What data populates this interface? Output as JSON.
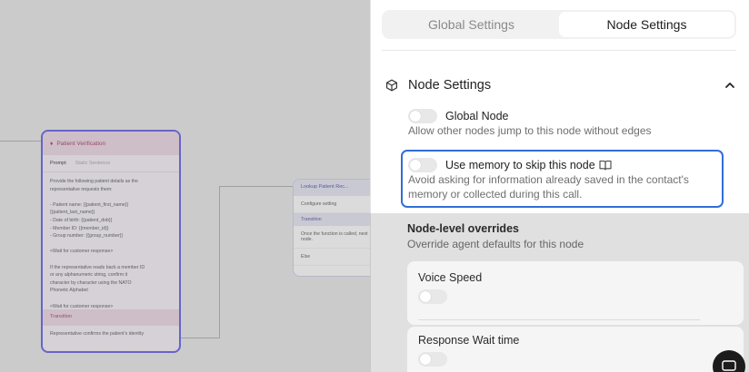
{
  "tabs": {
    "global_label": "Global Settings",
    "node_label": "Node Settings",
    "active": "Node Settings"
  },
  "section": {
    "title": "Node Settings",
    "icon": "cube-icon",
    "collapse_icon": "chevron-up-icon"
  },
  "options": {
    "global_node": {
      "title": "Global Node",
      "description": "Allow other nodes jump to this node without edges",
      "enabled": false
    },
    "memory": {
      "title": "Use memory to skip this node",
      "description": "Avoid asking for information already saved in the contact's memory or collected during this call.",
      "icon": "book-icon",
      "enabled": false
    }
  },
  "overrides": {
    "title": "Node-level overrides",
    "description": "Override agent defaults for this node",
    "voice_speed_label": "Voice Speed",
    "response_wait_label": "Response Wait time"
  },
  "canvas": {
    "patient_node": {
      "title": "Patient Verification",
      "tab_prompt": "Prompt",
      "tab_static": "Static Sentence",
      "prompt_text": "Provide the following patient details as the\nrepresentative requests them:\n\n- Patient name: {{patient_first_name}}\n{{patient_last_name}}\n- Date of birth: {{patient_dob}}\n- Member ID: {{member_id}}\n- Group number: {{group_number}}\n\n<Wait for customer response>\n\nIf the representative reads back a member ID\nor any alphanumeric string, confirm it\ncharacter by character using the NATO\nPhonetic Alphabet\n\n<Wait for customer response>",
      "transition_label": "Transition",
      "transition_item": "Representative confirms the patient's identity"
    },
    "lookup_node": {
      "title": "Lookup Patient Rec...",
      "configure_label": "Configure setting",
      "transition_label": "Transition",
      "transition_item": "Once the function is called, next node.",
      "else_label": "Else"
    }
  },
  "colors": {
    "accent_blue": "#2f6fd6",
    "patient_border": "#6f6ae6",
    "patient_header": "#ead7e2"
  }
}
